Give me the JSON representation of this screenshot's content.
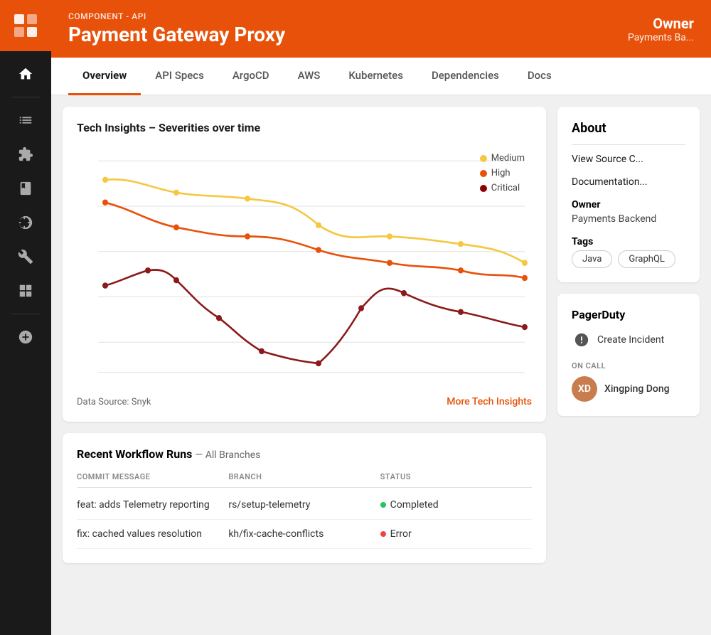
{
  "sidebar": {
    "logo_alt": "Logo",
    "icons": [
      {
        "name": "home-icon",
        "symbol": "⌂",
        "active": false
      },
      {
        "name": "list-icon",
        "symbol": "☰",
        "active": false
      },
      {
        "name": "puzzle-icon",
        "symbol": "⚙",
        "active": false
      },
      {
        "name": "book-icon",
        "symbol": "📖",
        "active": false
      },
      {
        "name": "compass-icon",
        "symbol": "◎",
        "active": false
      },
      {
        "name": "wrench-icon",
        "symbol": "🔧",
        "active": false
      },
      {
        "name": "grid-icon",
        "symbol": "⊞",
        "active": false
      },
      {
        "name": "plus-icon",
        "symbol": "+",
        "active": false
      }
    ]
  },
  "header": {
    "subtitle": "COMPONENT - API",
    "title": "Payment Gateway Proxy",
    "owner_label": "Owner",
    "owner_value": "Payments Ba..."
  },
  "nav": {
    "tabs": [
      {
        "id": "overview",
        "label": "Overview",
        "active": true
      },
      {
        "id": "api-specs",
        "label": "API Specs",
        "active": false
      },
      {
        "id": "argocd",
        "label": "ArgoCD",
        "active": false
      },
      {
        "id": "aws",
        "label": "AWS",
        "active": false
      },
      {
        "id": "kubernetes",
        "label": "Kubernetes",
        "active": false
      },
      {
        "id": "dependencies",
        "label": "Dependencies",
        "active": false
      },
      {
        "id": "docs",
        "label": "Docs",
        "active": false
      }
    ]
  },
  "chart": {
    "title": "Tech Insights – Severities over time",
    "legend": {
      "medium": {
        "label": "Medium",
        "color": "#f5c842"
      },
      "high": {
        "label": "High",
        "color": "#e8510a"
      },
      "critical": {
        "label": "Critical",
        "color": "#8b0000"
      }
    },
    "data_source": "Data Source: Snyk",
    "more_insights": "More Tech Insights"
  },
  "workflow": {
    "title": "Recent Workflow Runs",
    "subtitle": "— All Branches",
    "columns": [
      "COMMIT MESSAGE",
      "BRANCH",
      "STATUS"
    ],
    "rows": [
      {
        "commit": "feat: adds Telemetry reporting",
        "branch": "rs/setup-telemetry",
        "status": "Completed",
        "status_type": "completed"
      },
      {
        "commit": "fix: cached values resolution",
        "branch": "kh/fix-cache-conflicts",
        "status": "Error",
        "status_type": "error"
      }
    ]
  },
  "about": {
    "title": "About",
    "view_source": "View Source C...",
    "documentation": "Documentation...",
    "owner_label": "Owner",
    "owner_value": "Payments Backend",
    "tags_label": "Tags",
    "tags": [
      "Java",
      "GraphQL"
    ]
  },
  "pagerduty": {
    "title": "PagerDuty",
    "create_incident_label": "Create Incident",
    "on_call_label": "ON CALL",
    "on_call_name": "Xingping Dong"
  },
  "colors": {
    "orange": "#e8510a",
    "dark": "#1a1a1a",
    "medium_line": "#f5c842",
    "high_line": "#e8510a",
    "critical_line": "#8b1a1a"
  }
}
